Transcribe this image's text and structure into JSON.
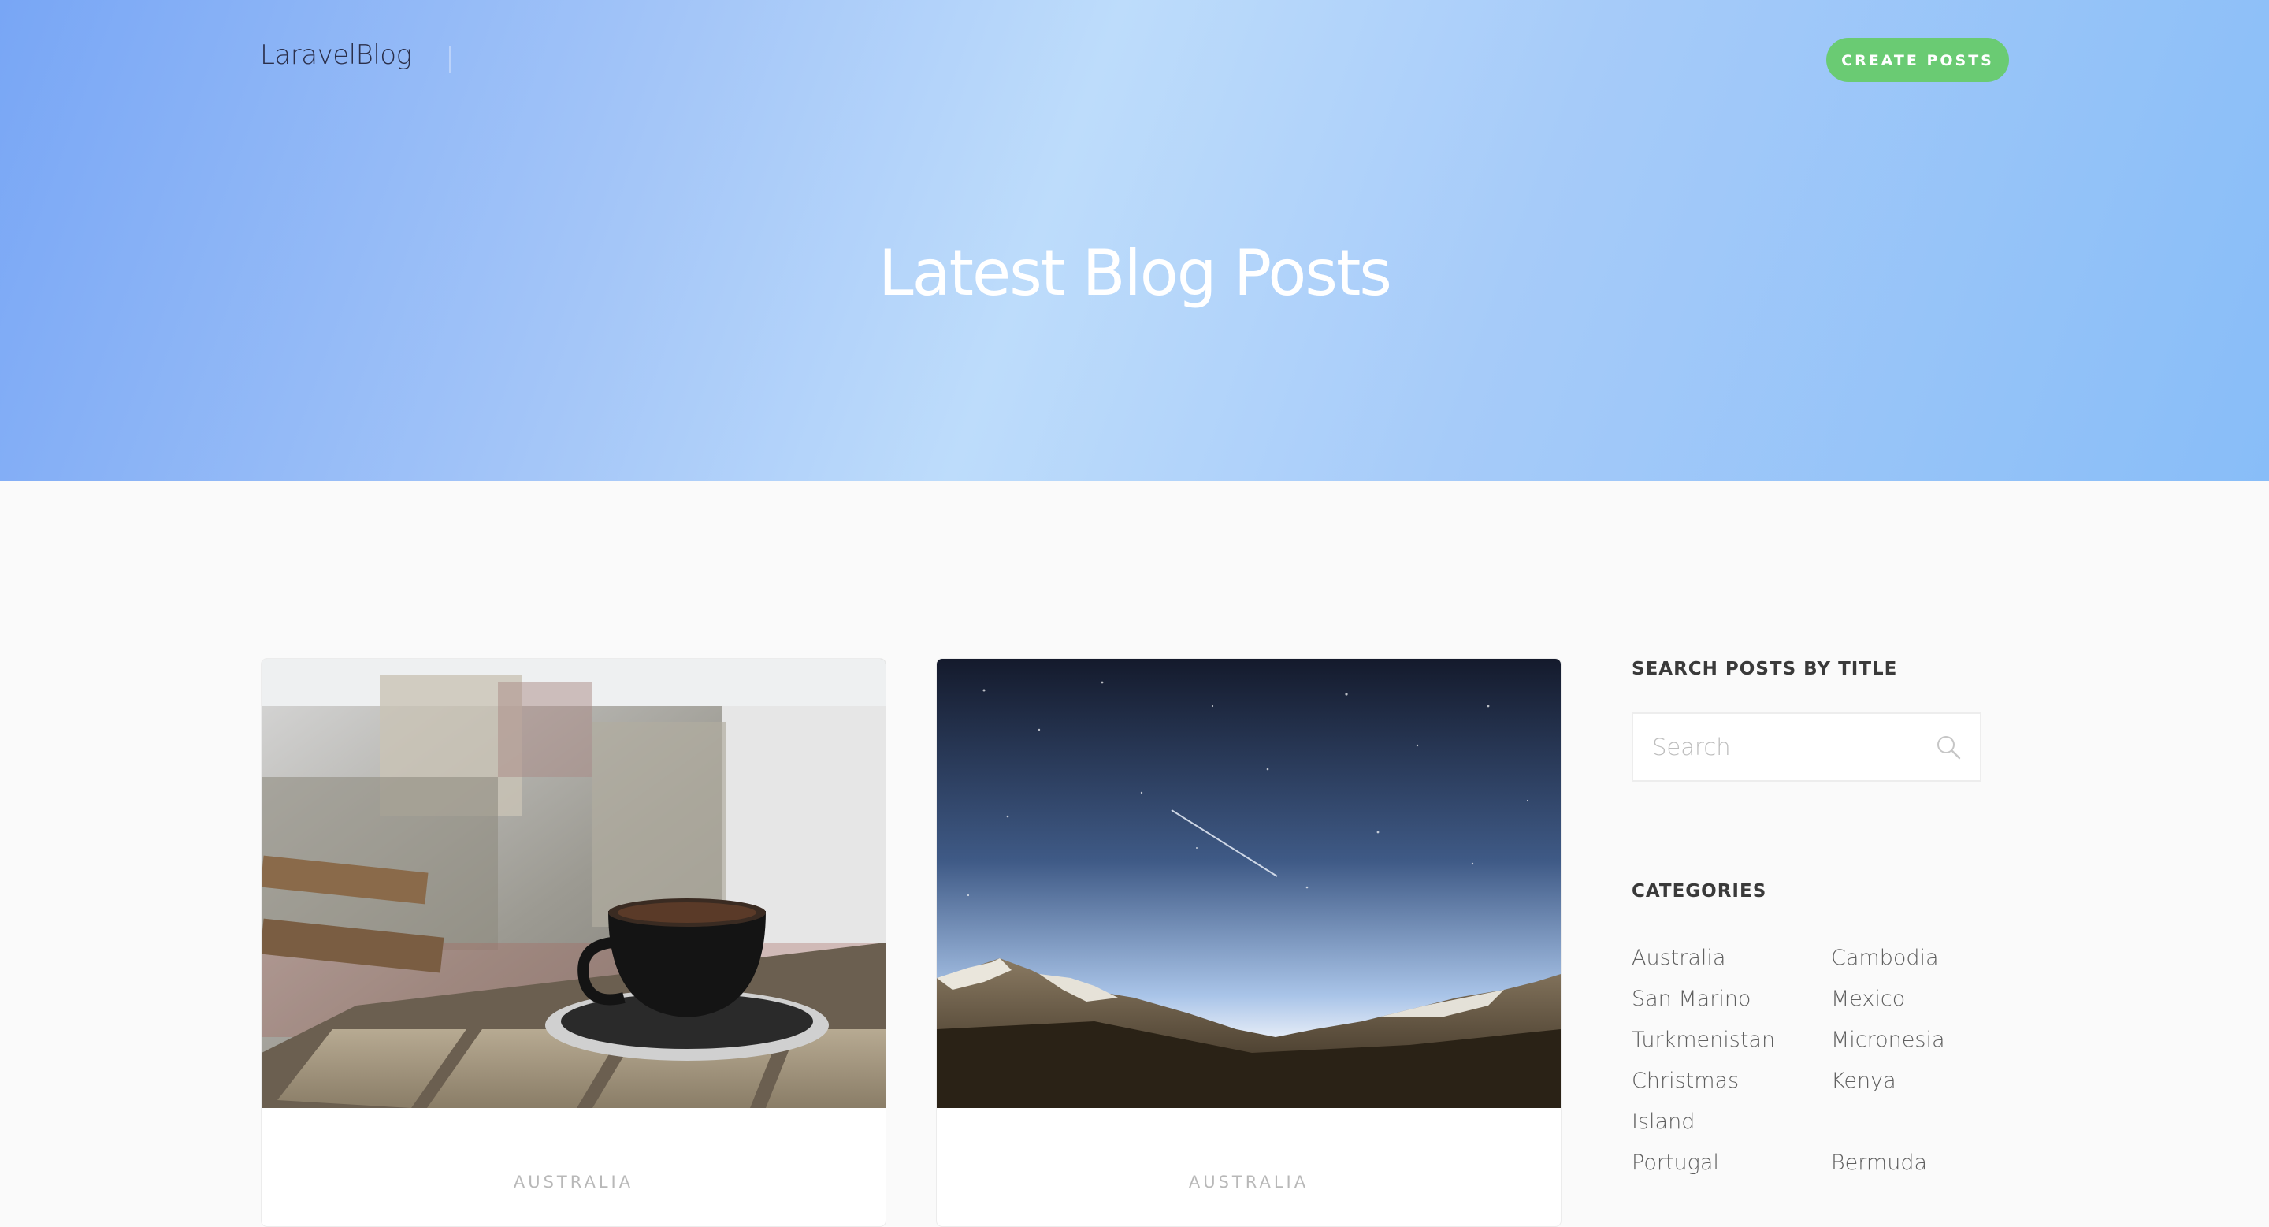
{
  "header": {
    "brand": "LaravelBlog",
    "create_button_label": "CREATE POSTS",
    "hero_title": "Latest Blog Posts"
  },
  "posts": [
    {
      "category": "AUSTRALIA",
      "image_subject": "coffee-cup-photo"
    },
    {
      "category": "AUSTRALIA",
      "image_subject": "night-sky-mountains-photo"
    }
  ],
  "sidebar": {
    "search_title": "SEARCH POSTS BY TITLE",
    "search_placeholder": "Search",
    "categories_title": "CATEGORIES",
    "categories": [
      "Australia",
      "Cambodia",
      "San Marino",
      "Mexico",
      "Turkmenistan",
      "Micronesia",
      "Christmas",
      "Kenya",
      "Island",
      "",
      "Portugal",
      "Bermuda"
    ]
  },
  "colors": {
    "hero_gradient_start": "#78a6f5",
    "hero_gradient_mid": "#bddcfb",
    "hero_gradient_end": "#88bdf8",
    "create_button": "#6acb73",
    "page_background": "#fafafa"
  },
  "icons": {
    "search": "search-icon"
  }
}
